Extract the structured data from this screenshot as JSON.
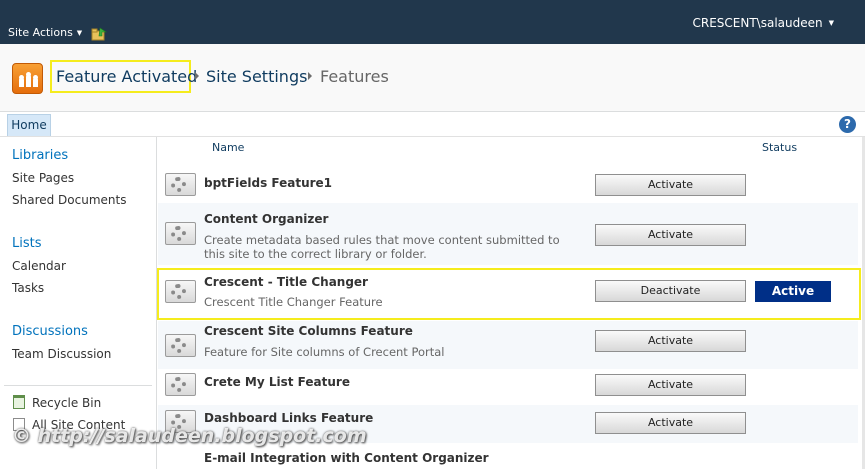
{
  "topbar": {
    "site_actions": "Site Actions",
    "user": "CRESCENT\\salaudeen"
  },
  "breadcrumb": {
    "items": [
      "Feature Activated",
      "Site Settings",
      "Features"
    ]
  },
  "tabs": {
    "home": "Home",
    "help": "?"
  },
  "leftnav": {
    "libraries": "Libraries",
    "site_pages": "Site Pages",
    "shared_documents": "Shared Documents",
    "lists": "Lists",
    "calendar": "Calendar",
    "tasks": "Tasks",
    "discussions": "Discussions",
    "team_discussion": "Team Discussion",
    "recycle_bin": "Recycle Bin",
    "all_site_content": "All Site Content"
  },
  "list": {
    "col_name": "Name",
    "col_status": "Status",
    "features": [
      {
        "title": "bptFields Feature1",
        "desc": "",
        "button": "Activate",
        "status": ""
      },
      {
        "title": "Content Organizer",
        "desc": "Create metadata based rules that move content submitted to this site to the correct library or folder.",
        "button": "Activate",
        "status": ""
      },
      {
        "title": "Crescent - Title Changer",
        "desc": "Crescent Title Changer Feature",
        "button": "Deactivate",
        "status": "Active"
      },
      {
        "title": "Crescent Site Columns Feature",
        "desc": "Feature for Site columns of Crecent Portal",
        "button": "Activate",
        "status": ""
      },
      {
        "title": "Crete My List Feature",
        "desc": "",
        "button": "Activate",
        "status": ""
      },
      {
        "title": "Dashboard Links Feature",
        "desc": "",
        "button": "Activate",
        "status": ""
      },
      {
        "title": "E-mail Integration with Content Organizer",
        "desc": "",
        "button": "",
        "status": ""
      }
    ]
  },
  "watermark": "© http://salaudeen.blogspot.com",
  "colors": {
    "topbar": "#21374c",
    "active_badge": "#002f87",
    "highlight": "#f5ec1d",
    "link": "#0072bc"
  }
}
